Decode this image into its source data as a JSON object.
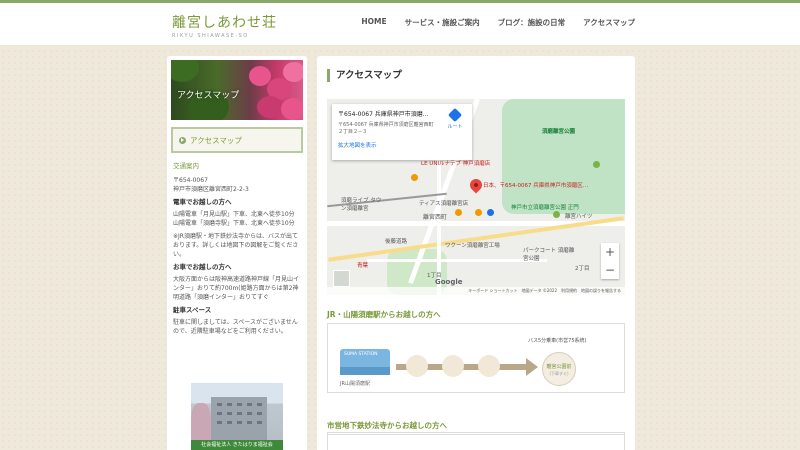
{
  "site": {
    "logo_jp": "離宮しあわせ荘",
    "logo_en": "RIKYU SHIAWASE-SO",
    "accent": "#8aa86a"
  },
  "nav": {
    "items": [
      {
        "label": "HOME"
      },
      {
        "label": "サービス・施設ご案内"
      },
      {
        "label": "ブログ：施設の日常"
      },
      {
        "label": "アクセスマップ"
      }
    ]
  },
  "sidebar": {
    "banner_title": "アクセスマップ",
    "nav_item": "アクセスマップ",
    "traffic_heading": "交通案内",
    "postal": "〒654-0067",
    "address": "神戸市須磨区離宮西町2-2-3",
    "train_heading": "電車でお越しの方へ",
    "train_lines": [
      "山陽電車「月見山駅」下車、北東へ徒歩10分",
      "山陽電車「須磨寺駅」下車、北東へ徒歩10分"
    ],
    "train_note": "※JR須磨駅・地下鉄妙法寺からは、バスが出ております。詳しくは地図下の図解をご覧ください。",
    "car_heading": "お車でお越しの方へ",
    "car_text": "大阪方面からは阪神高速道路神戸線「月見山インター」おりて約700m(姫路方面からは第2神明道路「須磨インター」おりてすぐ",
    "parking_heading": "駐車スペース",
    "parking_text": "駐車に関しましては、スペースがございませんので、近隣駐車場などをご利用ください。",
    "photo_caption": "社会福祉法人 きたはりま福祉会"
  },
  "main": {
    "page_title": "アクセスマップ",
    "map": {
      "card_title": "〒654-0067 兵庫県神戸市須磨...",
      "card_address": "〒654-0067 兵庫県神戸市須磨区離宮西町２丁目２−３",
      "card_link": "拡大地図を表示",
      "route_label": "ルート",
      "pin_label": "日本、〒654-0067 兵庫県神戸市須磨区…",
      "park_label": "須磨離宮公園",
      "park_sub": "神戸市立須磨離宮公園 正門",
      "labels": [
        "LE UNIルナテブ 神戸須磨店",
        "須磨ライブ タウン須磨離宮",
        "ティアス須磨離宮店",
        "離宮西町",
        "離宮ハイツ",
        "後藤道路",
        "ワクーン須磨離宮工場",
        "パークコート 須磨離宮公園",
        "1丁目",
        "2丁目",
        "青葉"
      ],
      "google": "Google",
      "footer": "キーボード ショートカット　地図データ ©2022　利用規約　地図の誤りを報告する"
    },
    "section1_title": "JR・山陽須磨駅からお越しの方へ",
    "route1": {
      "station_sign": "SUMA STATION",
      "station_label": "JR山陽須磨駅",
      "bus_time": "バス5分乗車(市営75系統)",
      "dest_name": "離宮公園前",
      "dest_sub": "(下車すぐ)"
    },
    "section2_title": "市営地下鉄妙法寺からお越しの方へ"
  }
}
